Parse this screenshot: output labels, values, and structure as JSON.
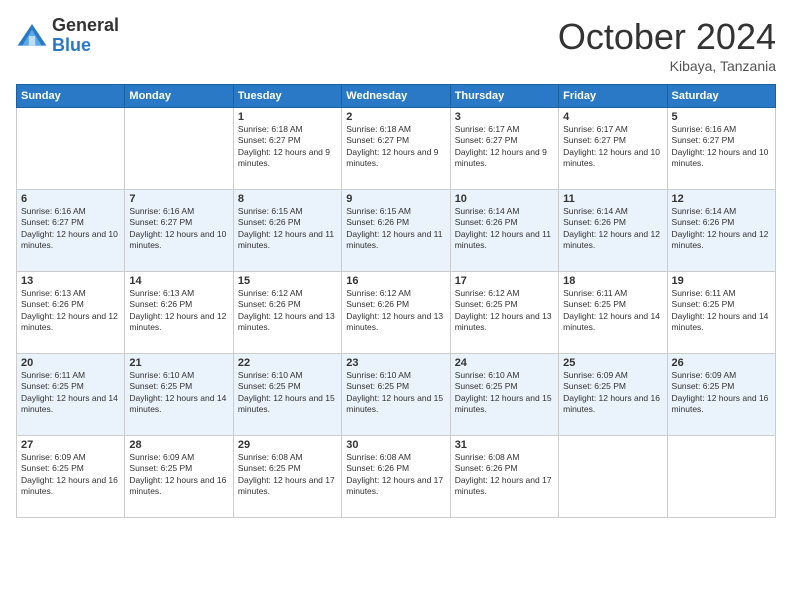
{
  "logo": {
    "general": "General",
    "blue": "Blue"
  },
  "header": {
    "month": "October 2024",
    "location": "Kibaya, Tanzania"
  },
  "days_of_week": [
    "Sunday",
    "Monday",
    "Tuesday",
    "Wednesday",
    "Thursday",
    "Friday",
    "Saturday"
  ],
  "weeks": [
    [
      {
        "day": "",
        "info": ""
      },
      {
        "day": "",
        "info": ""
      },
      {
        "day": "1",
        "info": "Sunrise: 6:18 AM\nSunset: 6:27 PM\nDaylight: 12 hours and 9 minutes."
      },
      {
        "day": "2",
        "info": "Sunrise: 6:18 AM\nSunset: 6:27 PM\nDaylight: 12 hours and 9 minutes."
      },
      {
        "day": "3",
        "info": "Sunrise: 6:17 AM\nSunset: 6:27 PM\nDaylight: 12 hours and 9 minutes."
      },
      {
        "day": "4",
        "info": "Sunrise: 6:17 AM\nSunset: 6:27 PM\nDaylight: 12 hours and 10 minutes."
      },
      {
        "day": "5",
        "info": "Sunrise: 6:16 AM\nSunset: 6:27 PM\nDaylight: 12 hours and 10 minutes."
      }
    ],
    [
      {
        "day": "6",
        "info": "Sunrise: 6:16 AM\nSunset: 6:27 PM\nDaylight: 12 hours and 10 minutes."
      },
      {
        "day": "7",
        "info": "Sunrise: 6:16 AM\nSunset: 6:27 PM\nDaylight: 12 hours and 10 minutes."
      },
      {
        "day": "8",
        "info": "Sunrise: 6:15 AM\nSunset: 6:26 PM\nDaylight: 12 hours and 11 minutes."
      },
      {
        "day": "9",
        "info": "Sunrise: 6:15 AM\nSunset: 6:26 PM\nDaylight: 12 hours and 11 minutes."
      },
      {
        "day": "10",
        "info": "Sunrise: 6:14 AM\nSunset: 6:26 PM\nDaylight: 12 hours and 11 minutes."
      },
      {
        "day": "11",
        "info": "Sunrise: 6:14 AM\nSunset: 6:26 PM\nDaylight: 12 hours and 12 minutes."
      },
      {
        "day": "12",
        "info": "Sunrise: 6:14 AM\nSunset: 6:26 PM\nDaylight: 12 hours and 12 minutes."
      }
    ],
    [
      {
        "day": "13",
        "info": "Sunrise: 6:13 AM\nSunset: 6:26 PM\nDaylight: 12 hours and 12 minutes."
      },
      {
        "day": "14",
        "info": "Sunrise: 6:13 AM\nSunset: 6:26 PM\nDaylight: 12 hours and 12 minutes."
      },
      {
        "day": "15",
        "info": "Sunrise: 6:12 AM\nSunset: 6:26 PM\nDaylight: 12 hours and 13 minutes."
      },
      {
        "day": "16",
        "info": "Sunrise: 6:12 AM\nSunset: 6:26 PM\nDaylight: 12 hours and 13 minutes."
      },
      {
        "day": "17",
        "info": "Sunrise: 6:12 AM\nSunset: 6:25 PM\nDaylight: 12 hours and 13 minutes."
      },
      {
        "day": "18",
        "info": "Sunrise: 6:11 AM\nSunset: 6:25 PM\nDaylight: 12 hours and 14 minutes."
      },
      {
        "day": "19",
        "info": "Sunrise: 6:11 AM\nSunset: 6:25 PM\nDaylight: 12 hours and 14 minutes."
      }
    ],
    [
      {
        "day": "20",
        "info": "Sunrise: 6:11 AM\nSunset: 6:25 PM\nDaylight: 12 hours and 14 minutes."
      },
      {
        "day": "21",
        "info": "Sunrise: 6:10 AM\nSunset: 6:25 PM\nDaylight: 12 hours and 14 minutes."
      },
      {
        "day": "22",
        "info": "Sunrise: 6:10 AM\nSunset: 6:25 PM\nDaylight: 12 hours and 15 minutes."
      },
      {
        "day": "23",
        "info": "Sunrise: 6:10 AM\nSunset: 6:25 PM\nDaylight: 12 hours and 15 minutes."
      },
      {
        "day": "24",
        "info": "Sunrise: 6:10 AM\nSunset: 6:25 PM\nDaylight: 12 hours and 15 minutes."
      },
      {
        "day": "25",
        "info": "Sunrise: 6:09 AM\nSunset: 6:25 PM\nDaylight: 12 hours and 16 minutes."
      },
      {
        "day": "26",
        "info": "Sunrise: 6:09 AM\nSunset: 6:25 PM\nDaylight: 12 hours and 16 minutes."
      }
    ],
    [
      {
        "day": "27",
        "info": "Sunrise: 6:09 AM\nSunset: 6:25 PM\nDaylight: 12 hours and 16 minutes."
      },
      {
        "day": "28",
        "info": "Sunrise: 6:09 AM\nSunset: 6:25 PM\nDaylight: 12 hours and 16 minutes."
      },
      {
        "day": "29",
        "info": "Sunrise: 6:08 AM\nSunset: 6:25 PM\nDaylight: 12 hours and 17 minutes."
      },
      {
        "day": "30",
        "info": "Sunrise: 6:08 AM\nSunset: 6:26 PM\nDaylight: 12 hours and 17 minutes."
      },
      {
        "day": "31",
        "info": "Sunrise: 6:08 AM\nSunset: 6:26 PM\nDaylight: 12 hours and 17 minutes."
      },
      {
        "day": "",
        "info": ""
      },
      {
        "day": "",
        "info": ""
      }
    ]
  ]
}
